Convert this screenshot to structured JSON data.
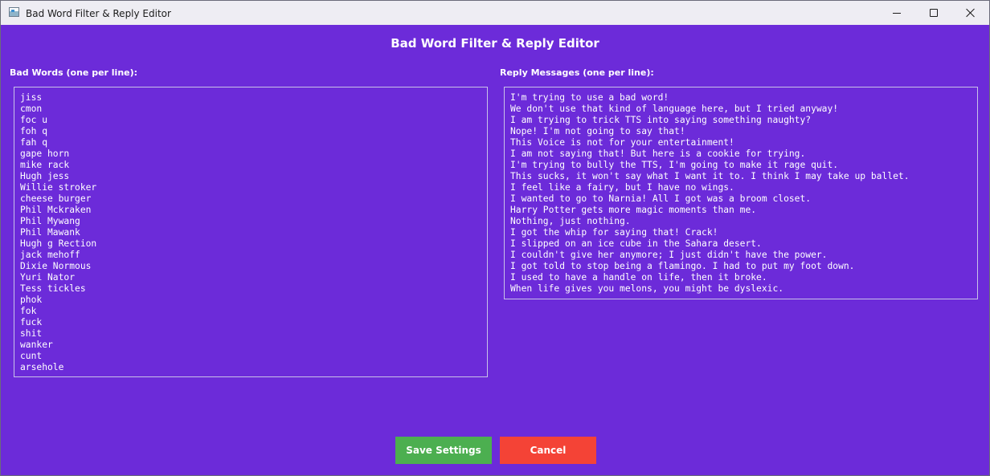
{
  "window": {
    "title": "Bad Word Filter & Reply Editor",
    "icon": "app-window-icon"
  },
  "header": {
    "title": "Bad Word Filter & Reply Editor"
  },
  "bad_words": {
    "label": "Bad Words (one per line):",
    "lines": [
      "jiss",
      "cmon",
      "foc u",
      "foh q",
      "fah q",
      "gape horn",
      "mike rack",
      "Hugh jess",
      "Willie stroker",
      "cheese burger",
      "Phil Mckraken",
      "Phil Mywang",
      "Phil Mawank",
      "Hugh g Rection",
      "jack mehoff",
      "Dixie Normous",
      "Yuri Nator",
      "Tess tickles",
      "phok",
      "fok",
      "fuck",
      "shit",
      "wanker",
      "cunt",
      "arsehole"
    ]
  },
  "replies": {
    "label": "Reply Messages (one per line):",
    "lines": [
      "I'm trying to use a bad word!",
      "We don't use that kind of language here, but I tried anyway!",
      "I am trying to trick TTS into saying something naughty?",
      "Nope! I'm not going to say that!",
      "This Voice is not for your entertainment!",
      "I am not saying that! But here is a cookie for trying.",
      "I'm trying to bully the TTS, I'm going to make it rage quit.",
      "This sucks, it won't say what I want it to. I think I may take up ballet.",
      "I feel like a fairy, but I have no wings.",
      "I wanted to go to Narnia! All I got was a broom closet.",
      "Harry Potter gets more magic moments than me.",
      "Nothing, just nothing.",
      "I got the whip for saying that! Crack!",
      "I slipped on an ice cube in the Sahara desert.",
      "I couldn't give her anymore; I just didn't have the power.",
      "I got told to stop being a flamingo. I had to put my foot down.",
      "I used to have a handle on life, then it broke.",
      "When life gives you melons, you might be dyslexic."
    ]
  },
  "buttons": {
    "save_label": "Save Settings",
    "cancel_label": "Cancel"
  },
  "colors": {
    "background": "#6c2bd9",
    "save": "#4caf50",
    "cancel": "#f44336",
    "text": "#ffffff"
  }
}
